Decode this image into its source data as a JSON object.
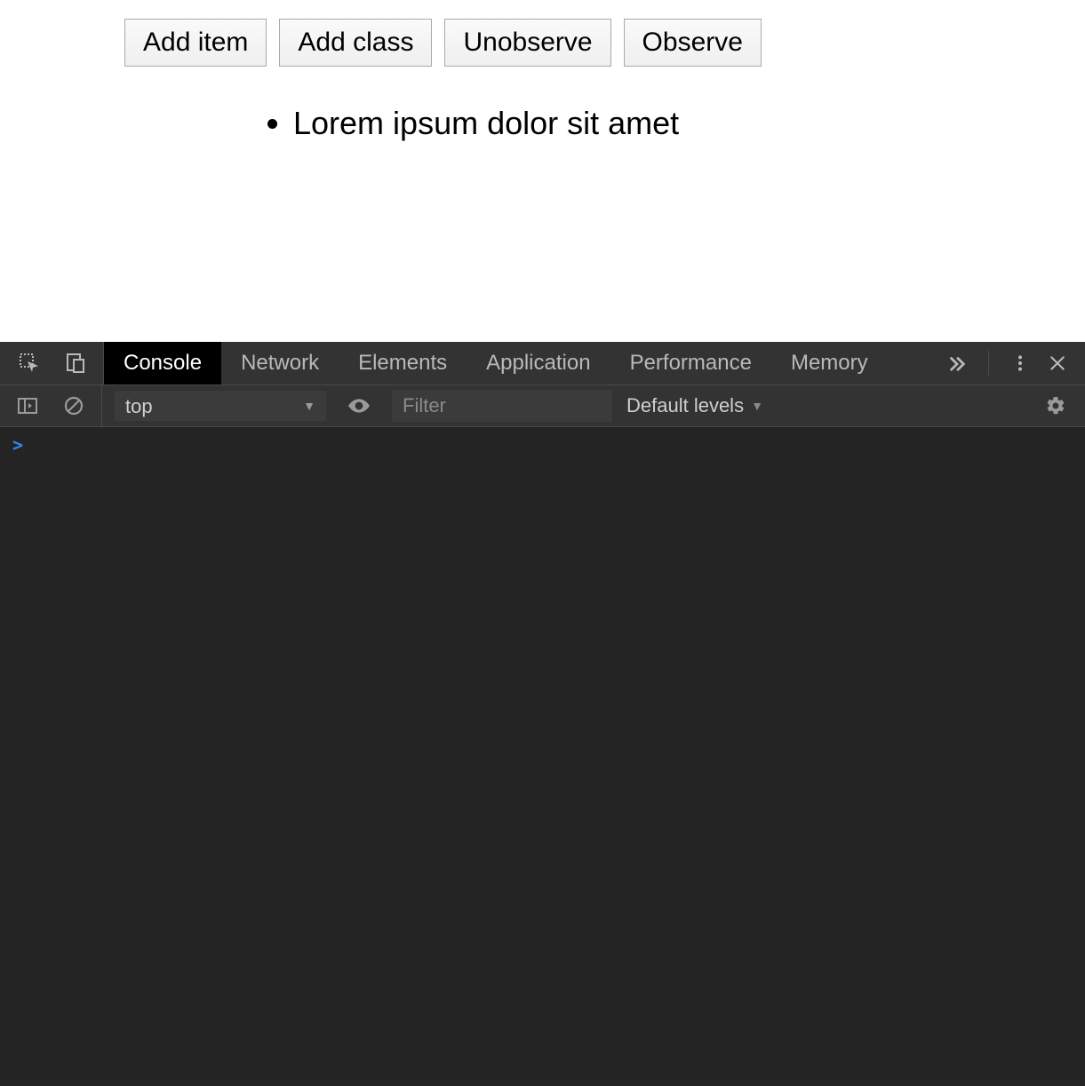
{
  "buttons": {
    "add_item": "Add item",
    "add_class": "Add class",
    "unobserve": "Unobserve",
    "observe": "Observe"
  },
  "list": {
    "items": [
      "Lorem ipsum dolor sit amet"
    ]
  },
  "devtools": {
    "tabs": {
      "console": "Console",
      "network": "Network",
      "elements": "Elements",
      "application": "Application",
      "performance": "Performance",
      "memory": "Memory"
    },
    "toolbar": {
      "context": "top",
      "filter_placeholder": "Filter",
      "levels": "Default levels"
    },
    "prompt": ">"
  }
}
